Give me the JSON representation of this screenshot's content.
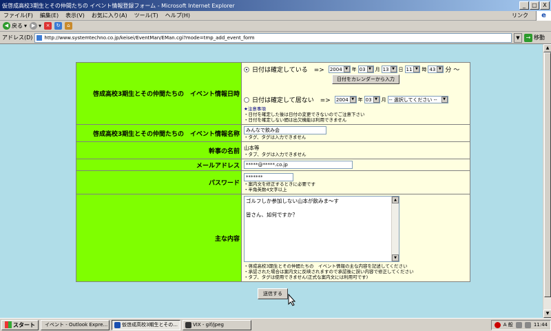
{
  "window": {
    "title": "仮啓成高校3期生とその仲間たちの イベント情報登録フォーム - Microsoft Internet Explorer",
    "buttons": [
      "_",
      "□",
      "X"
    ]
  },
  "menu": {
    "items": [
      "ファイル(F)",
      "編集(E)",
      "表示(V)",
      "お気に入り(A)",
      "ツール(T)",
      "ヘルプ(H)"
    ],
    "link_label": "リンク"
  },
  "toolbar": {
    "back_label": "戻る"
  },
  "address": {
    "label": "アドレス(D)",
    "url": "http://www.systemtechno.co.jp/keisei/EventMan/EMan.cgi?mode=tmp_add_event_form",
    "go_label": "移動"
  },
  "form": {
    "row_datetime": {
      "label": "啓成高校3期生とその仲間たちの　イベント情報日時",
      "option1_label": "日付は確定している　=>",
      "year": "2004",
      "year_unit": "年",
      "month": "03",
      "month_unit": "月",
      "day": "13",
      "day_unit": "日",
      "hour": "11",
      "hour_unit": "時",
      "minute": "43",
      "minute_unit": "分 〜",
      "calendar_button": "日付をカレンダーから入力",
      "option2_label": "日付は確定して居ない　=>",
      "year2": "2004",
      "month2": "03",
      "period_select": "-- 選択してください --",
      "notes_title": "★注意事項",
      "note1": "・日付を確定した後は日付の変更できないのでご注意下さい",
      "note2": "・日付を確定しない間は出欠機能は利用できません"
    },
    "row_name": {
      "label": "啓成高校3期生とその仲間たちの　イベント情報名称",
      "value": "みんなで飲み会",
      "note": "・タグ、タグは入力できません"
    },
    "row_organizer": {
      "label": "幹事の名前",
      "value": "山本等",
      "note": "・タブ、タグは入力できません"
    },
    "row_email": {
      "label": "メールアドレス",
      "value": "*****@*****.co.jp"
    },
    "row_password": {
      "label": "パスワード",
      "value": "*******",
      "note1": "・案内文を修正するときに必要です",
      "note2": "・半角英数4文字以上"
    },
    "row_content": {
      "label": "主な内容",
      "line1": "ゴルフしか参加しない山本が飲みま〜す",
      "line2": "皆さん、如何ですか？",
      "note1": "・啓成高校3期生とその仲間たちの　イベント情報の主な内容を記述してください",
      "note2": "・承認された場合は案内文に反映されますので承認後に誤い内容で修正してください",
      "note3": "・タブ、タグは使用できません(正式な案内文には利用可です)"
    },
    "submit_label": "送信する"
  },
  "taskbar": {
    "start_label": "スタート",
    "tasks": [
      "イベント - Outlook Expre...",
      "仮啓成高校3期生とその...",
      "VIX - gif/jpeg"
    ],
    "tray_text": "A 般",
    "clock": "11:44"
  }
}
